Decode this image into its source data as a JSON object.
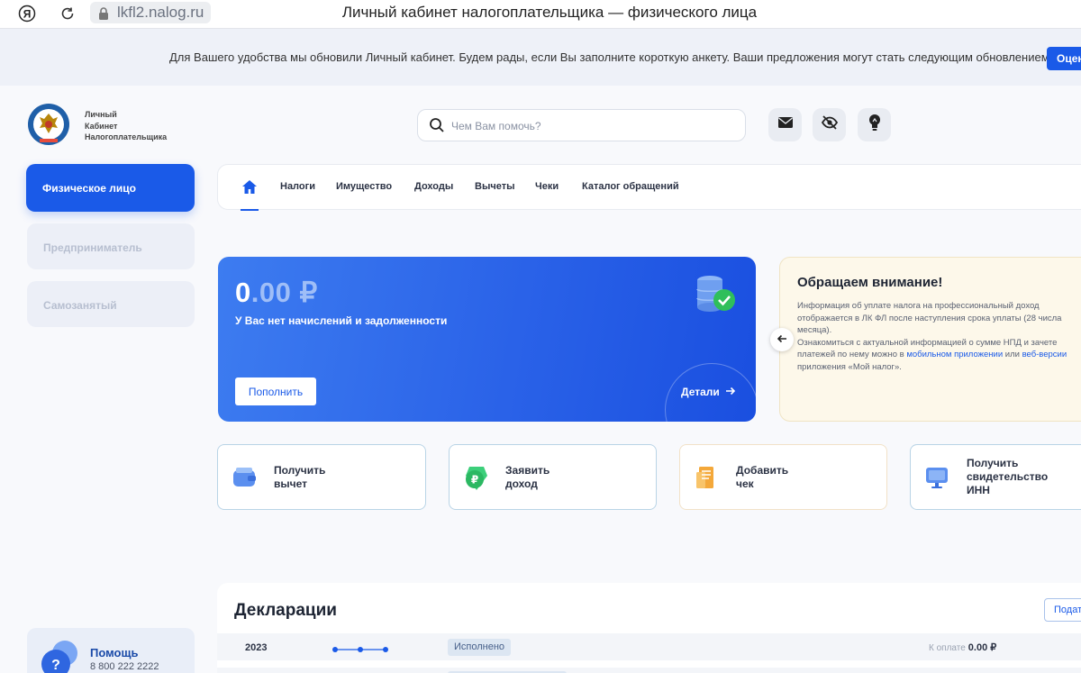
{
  "browser": {
    "url": "lkfl2.nalog.ru",
    "title": "Личный кабинет налогоплательщика — физического лица"
  },
  "banner": {
    "text": "Для Вашего удобства мы обновили Личный кабинет. Будем рады, если Вы заполните короткую анкету. Ваши предложения могут стать следующим обновлением",
    "button_label": "Оцен"
  },
  "logo": {
    "line1": "Личный",
    "line2": "Кабинет",
    "line3": "Налогоплательщика"
  },
  "search": {
    "placeholder": "Чем Вам помочь?"
  },
  "header_icons": [
    "mail-icon",
    "eye-off-icon",
    "lightbulb-icon"
  ],
  "sidebar": {
    "items": [
      {
        "label": "Физическое лицо",
        "active": true
      },
      {
        "label": "Предприниматель",
        "active": false
      },
      {
        "label": "Самозанятый",
        "active": false
      }
    ]
  },
  "nav": {
    "items": [
      "Налоги",
      "Имущество",
      "Доходы",
      "Вычеты",
      "Чеки",
      "Каталог обращений"
    ]
  },
  "balance": {
    "amount_int": "0",
    "amount_dec": ".00",
    "currency": "₽",
    "subtitle": "У Вас нет начислений и задолженности",
    "topup_label": "Пополнить",
    "details_label": "Детали"
  },
  "notice": {
    "title": "Обращаем внимание!",
    "p1": "Информация об уплате налога на профессиональный доход отображается в ЛК ФЛ после наступления срока уплаты (28 числа месяца).",
    "p2_start": "Ознакомиться с актуальной информацией о сумме НПД и зачете платежей по нему можно в ",
    "link1": "мобильном приложении",
    "p2_mid": " или ",
    "link2": "веб-версии",
    "p2_end": " приложения «Мой налог»."
  },
  "tiles": [
    {
      "line1": "Получить",
      "line2": "вычет",
      "line3": ""
    },
    {
      "line1": "Заявить",
      "line2": "доход",
      "line3": ""
    },
    {
      "line1": "Добавить",
      "line2": "чек",
      "line3": ""
    },
    {
      "line1": "Получить",
      "line2": "свидетельство",
      "line3": "ИНН"
    }
  ],
  "declarations": {
    "title": "Декларации",
    "button_label": "Подат",
    "rows": [
      {
        "year": "2023",
        "status": "Исполнено",
        "pay_label": "К оплате",
        "pay_value": "0.00 ₽"
      }
    ]
  },
  "help": {
    "title": "Помощь",
    "phone": "8 800 222 2222"
  },
  "colors": {
    "accent": "#1a5ae8",
    "notice_bg": "#fdf8ea",
    "page_bg": "#f8f9fc"
  }
}
